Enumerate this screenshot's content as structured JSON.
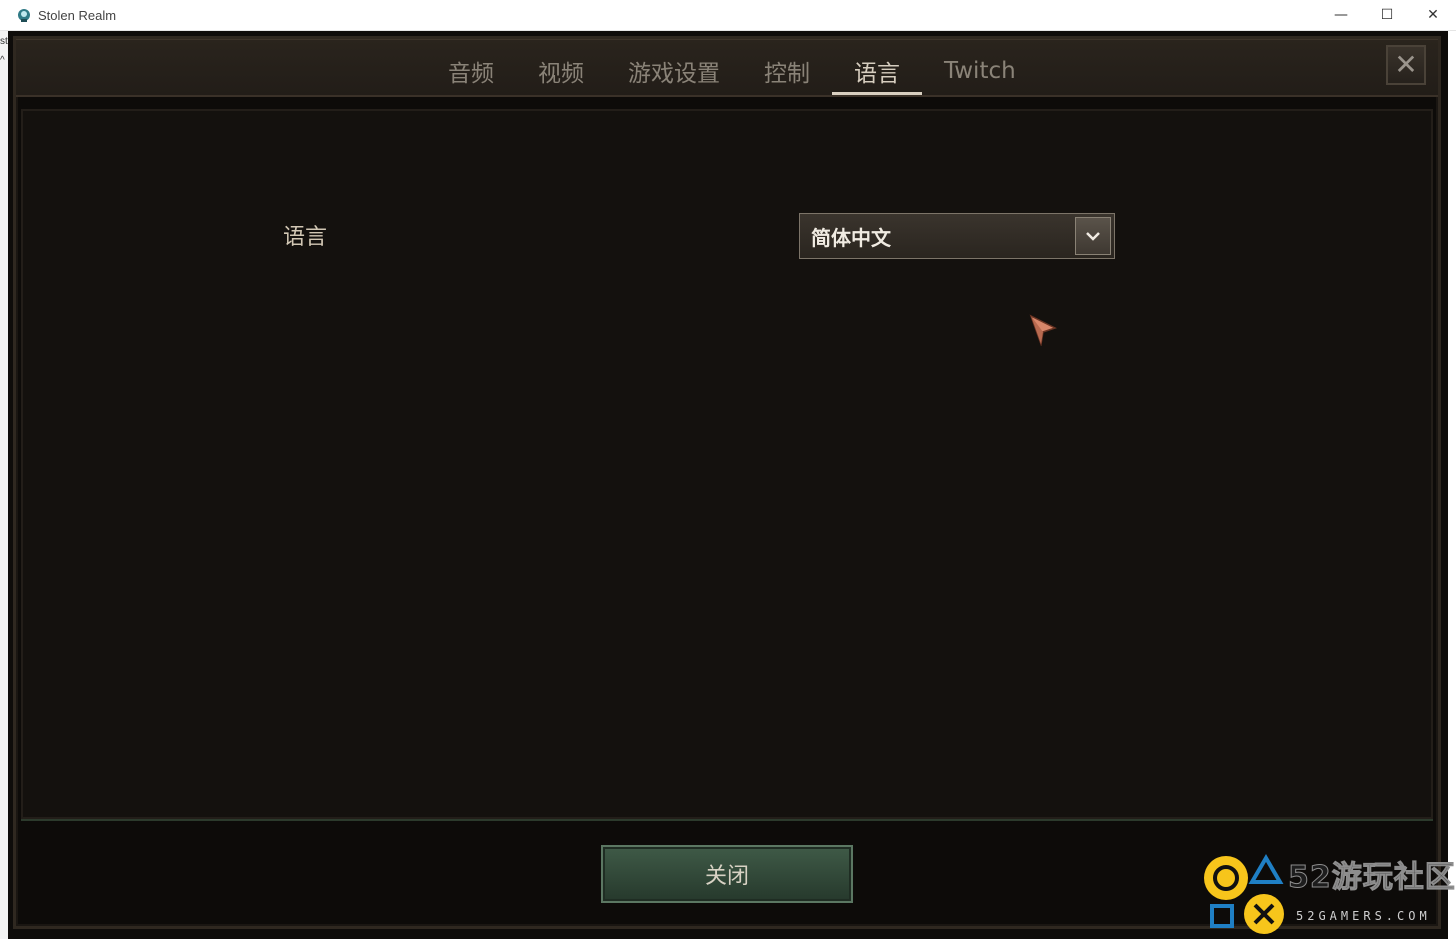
{
  "window": {
    "title": "Stolen Realm",
    "minimize": "—",
    "maximize": "☐",
    "close": "✕"
  },
  "left_strip": {
    "fragment": "st",
    "fragment2": "^"
  },
  "tabs": [
    {
      "label": "音频",
      "active": false
    },
    {
      "label": "视频",
      "active": false
    },
    {
      "label": "游戏设置",
      "active": false
    },
    {
      "label": "控制",
      "active": false
    },
    {
      "label": "语言",
      "active": true
    },
    {
      "label": "Twitch",
      "active": false
    }
  ],
  "panel_close": "✕",
  "language": {
    "label": "语言",
    "selected": "简体中文"
  },
  "footer": {
    "close_label": "关闭"
  },
  "watermark": {
    "brand": "52游玩社区",
    "url": "52GAMERS.COM"
  },
  "colors": {
    "active_tab": "#d6cdbf",
    "inactive_tab": "#8a8378",
    "button_green": "#3f5a47",
    "watermark_yellow": "#f7c51b",
    "watermark_blue": "#1f7fc4"
  }
}
